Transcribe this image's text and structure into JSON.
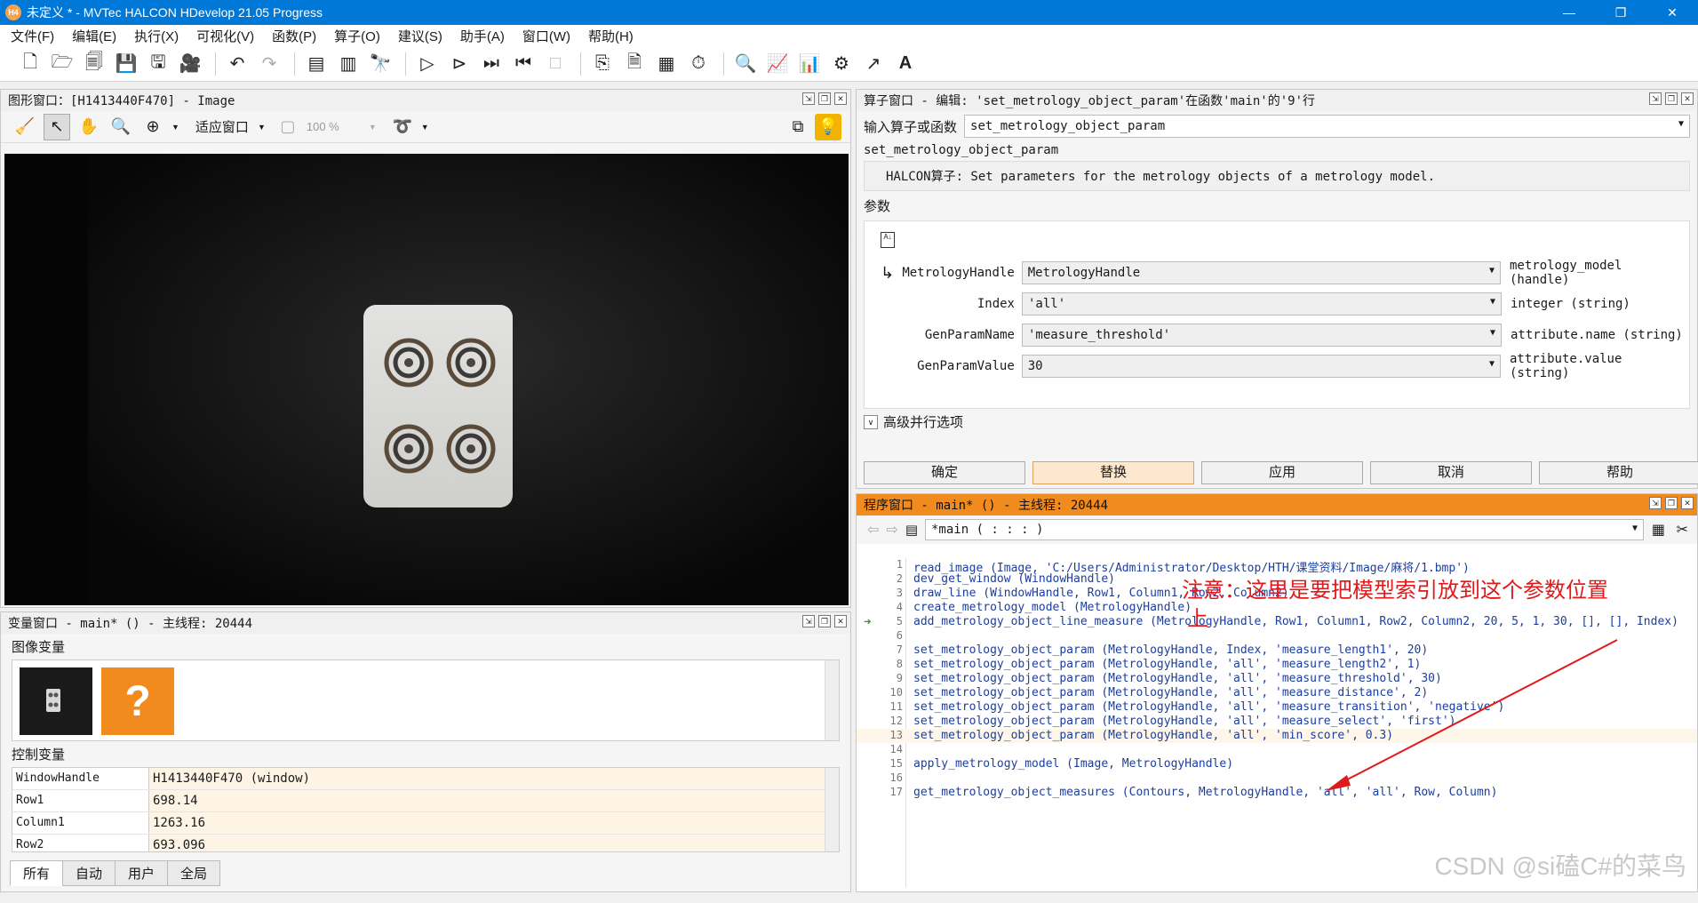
{
  "window": {
    "icon": "H4",
    "title": "未定义 * - MVTec HALCON HDevelop 21.05 Progress",
    "controls": [
      "—",
      "❐",
      "✕"
    ]
  },
  "menu": [
    "文件(F)",
    "编辑(E)",
    "执行(X)",
    "可视化(V)",
    "函数(P)",
    "算子(O)",
    "建议(S)",
    "助手(A)",
    "窗口(W)",
    "帮助(H)"
  ],
  "toolbar_icons": [
    "new-file-icon",
    "open-file-icon",
    "open-recent-icon",
    "save-icon",
    "save-all-icon",
    "record-icon",
    "undo-icon",
    "redo-icon",
    "insert-breakpoint-icon",
    "clear-breakpoint-icon",
    "find-icon",
    "run-icon",
    "step-over-icon",
    "step-into-icon",
    "step-out-icon",
    "stop-icon",
    "export-icon",
    "document-icon",
    "inspect-icon",
    "timer-icon",
    "zoom-icon",
    "histogram-icon",
    "line-profile-icon",
    "gray-icon",
    "feature-icon",
    "ocr-icon"
  ],
  "graphics_window": {
    "title": "图形窗口：[H1413440F470] - Image",
    "fit_label": "适应窗口",
    "zoom_value": "100 %"
  },
  "variable_window": {
    "title": "变量窗口 - main* () - 主线程: 20444",
    "image_vars_label": "图像变量",
    "control_vars_label": "控制变量",
    "unknown_glyph": "?",
    "control_vars": [
      {
        "name": "WindowHandle",
        "value": "H1413440F470 (window)"
      },
      {
        "name": "Row1",
        "value": "698.14"
      },
      {
        "name": "Column1",
        "value": "1263.16"
      },
      {
        "name": "Row2",
        "value": "693.096"
      }
    ],
    "tabs": [
      "所有",
      "自动",
      "用户",
      "全局"
    ]
  },
  "operator_window": {
    "title": "算子窗口 - 编辑: 'set_metrology_object_param'在函数'main'的'9'行",
    "search_label": "输入算子或函数",
    "search_value": "set_metrology_object_param",
    "op_name": "set_metrology_object_param",
    "op_desc": "HALCON算子: Set parameters for the metrology objects of a metrology model.",
    "params_label": "参数",
    "params": [
      {
        "name": "MetrologyHandle",
        "value": "MetrologyHandle",
        "type": "metrology_model (handle)"
      },
      {
        "name": "Index",
        "value": "'all'",
        "type": "integer (string)"
      },
      {
        "name": "GenParamName",
        "value": "'measure_threshold'",
        "type": "attribute.name (string)"
      },
      {
        "name": "GenParamValue",
        "value": "30",
        "type": "attribute.value (string)"
      }
    ],
    "advanced_label": "高级并行选项",
    "buttons": [
      "确定",
      "替换",
      "应用",
      "取消",
      "帮助"
    ]
  },
  "program_window": {
    "title": "程序窗口 - main* () - 主线程: 20444",
    "proc_value": "*main ( : : : )",
    "lines": [
      {
        "n": "1",
        "code": "read_image (Image, 'C:/Users/Administrator/Desktop/HTH/课堂资料/Image/麻将/1.bmp')"
      },
      {
        "n": "2",
        "code": "dev_get_window (WindowHandle)"
      },
      {
        "n": "3",
        "code": "draw_line (WindowHandle, Row1, Column1, Row2, Column2)"
      },
      {
        "n": "4",
        "code": "create_metrology_model (MetrologyHandle)"
      },
      {
        "n": "5",
        "code": "add_metrology_object_line_measure (MetrologyHandle, Row1, Column1, Row2, Column2, 20, 5, 1, 30, [], [], Index)"
      },
      {
        "n": "6",
        "code": ""
      },
      {
        "n": "7",
        "code": "set_metrology_object_param (MetrologyHandle, Index, 'measure_length1', 20)"
      },
      {
        "n": "8",
        "code": "set_metrology_object_param (MetrologyHandle, 'all', 'measure_length2', 1)"
      },
      {
        "n": "9",
        "code": "set_metrology_object_param (MetrologyHandle, 'all', 'measure_threshold', 30)"
      },
      {
        "n": "10",
        "code": "set_metrology_object_param (MetrologyHandle, 'all', 'measure_distance', 2)"
      },
      {
        "n": "11",
        "code": "set_metrology_object_param (MetrologyHandle, 'all', 'measure_transition', 'negative')"
      },
      {
        "n": "12",
        "code": "set_metrology_object_param (MetrologyHandle, 'all', 'measure_select', 'first')"
      },
      {
        "n": "13",
        "code": "set_metrology_object_param (MetrologyHandle, 'all', 'min_score', 0.3)"
      },
      {
        "n": "14",
        "code": ""
      },
      {
        "n": "15",
        "code": "apply_metrology_model (Image, MetrologyHandle)"
      },
      {
        "n": "16",
        "code": ""
      },
      {
        "n": "17",
        "code": "get_metrology_object_measures (Contours, MetrologyHandle, 'all', 'all', Row, Column)"
      }
    ],
    "annotation_line1": "注意：这里是要把模型索引放到这个参数位置",
    "annotation_line2": "上"
  },
  "watermark": "CSDN @si磕C#的菜鸟",
  "colors": {
    "titlebar": "#0078d7",
    "program_header": "#f28b1d",
    "annotation": "#e0191b",
    "code_text": "#1c3e9c"
  }
}
